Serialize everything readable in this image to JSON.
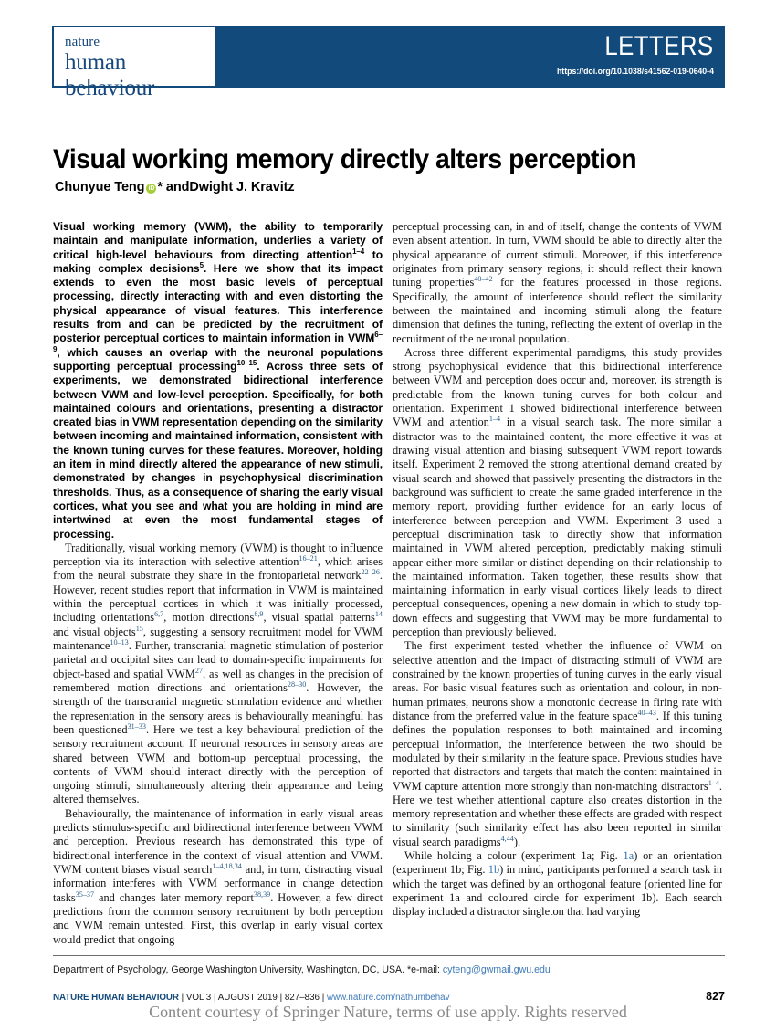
{
  "header": {
    "logo_line1": "nature",
    "logo_line2": "human behaviour",
    "section": "LETTERS",
    "doi": "https://doi.org/10.1038/s41562-019-0640-4",
    "band_color": "#134a7c",
    "logo_color": "#16477d"
  },
  "article": {
    "title": "Visual working memory directly alters perception",
    "author_first": "Chunyue Teng",
    "orcid_glyph": "iD",
    "orcid_color": "#a6ce39",
    "author_separator": "* and ",
    "author_second": "Dwight J. Kravitz"
  },
  "abstract": {
    "p1_a": "Visual working memory (VWM), the ability to temporarily maintain and manipulate information, underlies a variety of critical high-level behaviours from directing attention",
    "p1_sup1": "1–4",
    "p1_b": " to making complex decisions",
    "p1_sup2": "5",
    "p1_c": ". Here we show that its impact extends to even the most basic levels of perceptual processing, directly interacting with and even distorting the physical appearance of visual features. This interference results from and can be predicted by the recruitment of posterior perceptual cortices to maintain information in VWM",
    "p1_sup3": "6–9",
    "p1_d": ", which causes an overlap with the neuronal populations supporting perceptual processing",
    "p1_sup4": "10–15",
    "p1_e": ". Across three sets of experiments, we demonstrated bidirectional interference between VWM and low-level perception. Specifically, for both maintained colours and orientations, presenting a distractor created bias in VWM representation depending on the similarity between incoming and maintained information, consistent with the known tuning curves for these features. Moreover, holding an item in mind directly altered the appearance of new stimuli, demonstrated by changes in psychophysical discrimination thresholds. Thus, as a consequence of sharing the early visual cortices, what you see and what you are holding in mind are intertwined at even the most fundamental stages of processing."
  },
  "body_left": {
    "p1_a": "Traditionally, visual working memory (VWM) is thought to influence perception via its interaction with selective attention",
    "p1_sup1": "16–21",
    "p1_b": ", which arises from the neural substrate they share in the frontoparietal network",
    "p1_sup2": "22–26",
    "p1_c": ". However, recent studies report that information in VWM is maintained within the perceptual cortices in which it was initially processed, including orientations",
    "p1_sup3": "6,7",
    "p1_d": ", motion directions",
    "p1_sup4": "8,9",
    "p1_e": ", visual spatial patterns",
    "p1_sup5": "14",
    "p1_f": " and visual objects",
    "p1_sup6": "15",
    "p1_g": ", suggesting a sensory recruitment model for VWM maintenance",
    "p1_sup7": "10–13",
    "p1_h": ". Further, transcranial magnetic stimulation of posterior parietal and occipital sites can lead to domain-specific impairments for object-based and spatial VWM",
    "p1_sup8": "27",
    "p1_i": ", as well as changes in the precision of remembered motion directions and orientations",
    "p1_sup9": "28–30",
    "p1_j": ". However, the strength of the transcranial magnetic stimulation evidence and whether the representation in the sensory areas is behaviourally meaningful has been questioned",
    "p1_sup10": "31–33",
    "p1_k": ". Here we test a key behavioural prediction of the sensory recruitment account. If neuronal resources in sensory areas are shared between VWM and bottom-up perceptual processing, the contents of VWM should interact directly with the perception of ongoing stimuli, simultaneously altering their appearance and being altered themselves.",
    "p2_a": "Behaviourally, the maintenance of information in early visual areas predicts stimulus-specific and bidirectional interference between VWM and perception. Previous research has demonstrated this type of bidirectional interference in the context of visual attention and VWM. VWM content biases visual search",
    "p2_sup1": "1–4,18,34",
    "p2_b": " and, in turn, distracting visual information interferes with VWM performance in change detection tasks",
    "p2_sup2": "35–37",
    "p2_c": " and changes later memory report",
    "p2_sup3": "38,39",
    "p2_d": ". However, a few direct predictions from the common sensory recruitment by both perception and VWM remain untested. First, this overlap in early visual cortex would predict that ongoing"
  },
  "body_right": {
    "p1_a": "perceptual processing can, in and of itself, change the contents of VWM even absent attention. In turn, VWM should be able to directly alter the physical appearance of current stimuli. Moreover, if this interference originates from primary sensory regions, it should reflect their known tuning properties",
    "p1_sup1": "40–42",
    "p1_b": " for the features processed in those regions. Specifically, the amount of interference should reflect the similarity between the maintained and incoming stimuli along the feature dimension that defines the tuning, reflecting the extent of overlap in the recruitment of the neuronal population.",
    "p2_a": "Across three different experimental paradigms, this study provides strong psychophysical evidence that this bidirectional interference between VWM and perception does occur and, moreover, its strength is predictable from the known tuning curves for both colour and orientation. Experiment 1 showed bidirectional interference between VWM and attention",
    "p2_sup1": "1–4",
    "p2_b": " in a visual search task. The more similar a distractor was to the maintained content, the more effective it was at drawing visual attention and biasing subsequent VWM report towards itself. Experiment 2 removed the strong attentional demand created by visual search and showed that passively presenting the distractors in the background was sufficient to create the same graded interference in the memory report, providing further evidence for an early locus of interference between perception and VWM. Experiment 3 used a perceptual discrimination task to directly show that information maintained in VWM altered perception, predictably making stimuli appear either more similar or distinct depending on their relationship to the maintained information. Taken together, these results show that maintaining information in early visual cortices likely leads to direct perceptual consequences, opening a new domain in which to study top-down effects and suggesting that VWM may be more fundamental to perception than previously believed.",
    "p3_a": "The first experiment tested whether the influence of VWM on selective attention and the impact of distracting stimuli of VWM are constrained by the known properties of tuning curves in the early visual areas. For basic visual features such as orientation and colour, in non-human primates, neurons show a monotonic decrease in firing rate with distance from the preferred value in the feature space",
    "p3_sup1": "40–43",
    "p3_b": ". If this tuning defines the population responses to both maintained and incoming perceptual information, the interference between the two should be modulated by their similarity in the feature space. Previous studies have reported that distractors and targets that match the content maintained in VWM capture attention more strongly than non-matching distractors",
    "p3_sup2": "1–4",
    "p3_c": ". Here we test whether attentional capture also creates distortion in the memory representation and whether these effects are graded with respect to similarity (such similarity effect has also been reported in similar visual search paradigms",
    "p3_sup3": "4,44",
    "p3_d": ").",
    "p4_a": "While holding a colour (experiment 1a; Fig. ",
    "p4_link1": "1a",
    "p4_b": ") or an orientation (experiment 1b; Fig. ",
    "p4_link2": "1b",
    "p4_c": ") in mind, participants performed a search task in which the target was defined by an orthogonal feature (oriented line for experiment 1a and coloured circle for experiment 1b). Each search display included a distractor singleton that had varying"
  },
  "footer": {
    "affiliation": "Department of Psychology, George Washington University, Washington, DC, USA. *e-mail: ",
    "email": "cyteng@gwmail.gwu.edu",
    "journal_name": "NATURE HUMAN BEHAVIOUR",
    "journal_meta": " | VOL 3 | AUGUST 2019 | 827–836 | ",
    "journal_url": "www.nature.com/nathumbehav",
    "page_number": "827",
    "watermark": "Content courtesy of Springer Nature, terms of use apply. Rights reserved"
  }
}
